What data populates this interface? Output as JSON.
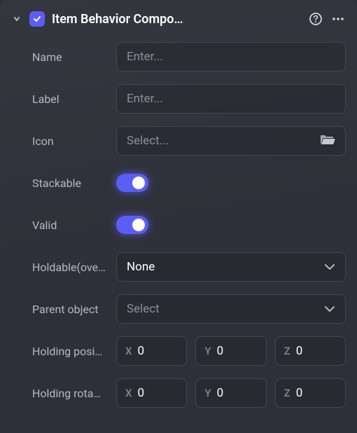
{
  "header": {
    "title": "Item Behavior Compo…",
    "enabled": true
  },
  "fields": {
    "name": {
      "label": "Name",
      "placeholder": "Enter...",
      "value": ""
    },
    "label": {
      "label": "Label",
      "placeholder": "Enter...",
      "value": ""
    },
    "icon": {
      "label": "Icon",
      "placeholder": "Select...",
      "value": ""
    },
    "stackable": {
      "label": "Stackable",
      "value": true
    },
    "valid": {
      "label": "Valid",
      "value": true
    },
    "holdable": {
      "label": "Holdable(ove…",
      "value": "None"
    },
    "parent": {
      "label": "Parent object",
      "placeholder": "Select",
      "value": ""
    },
    "holdingPosition": {
      "label": "Holding posi…",
      "x": "0",
      "y": "0",
      "z": "0"
    },
    "holdingRotation": {
      "label": "Holding rota…",
      "x": "0",
      "y": "0",
      "z": "0"
    }
  },
  "axes": {
    "x": "X",
    "y": "Y",
    "z": "Z"
  },
  "colors": {
    "accent": "#5b5ef5"
  }
}
